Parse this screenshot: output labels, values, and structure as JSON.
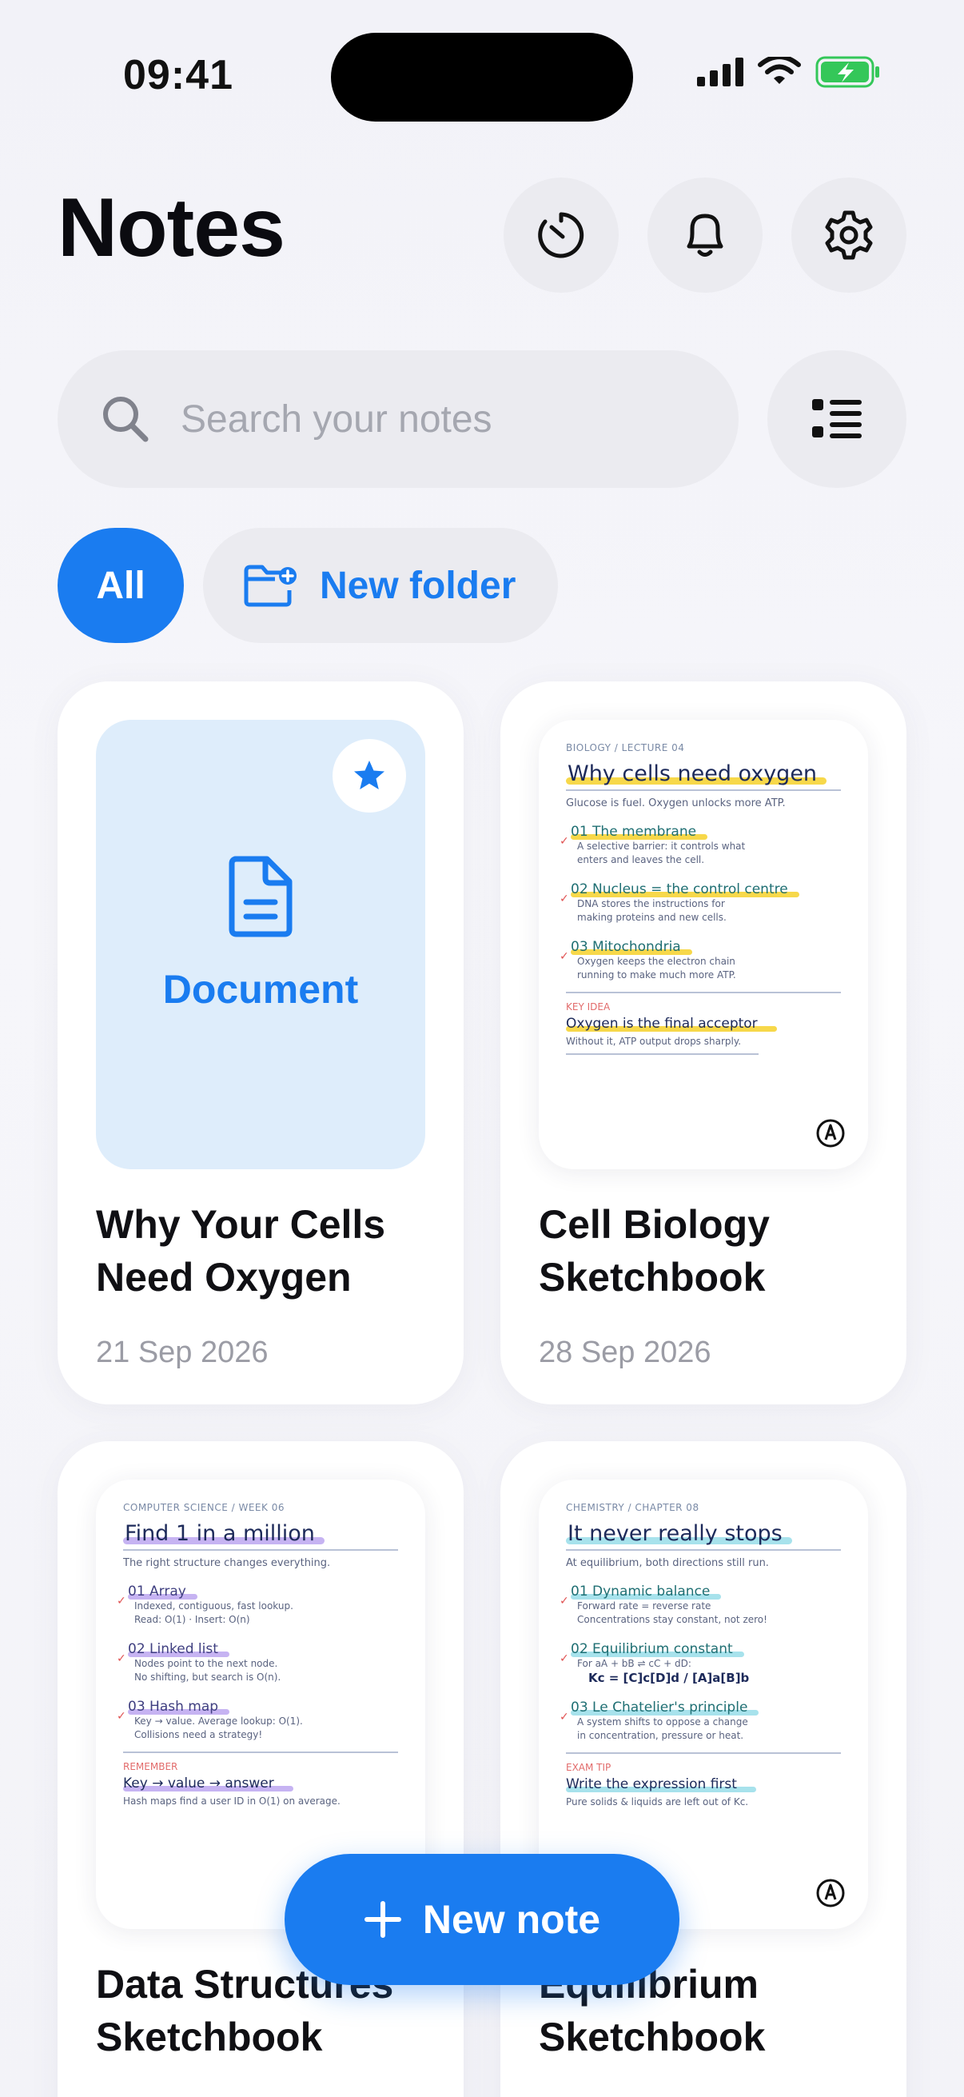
{
  "status": {
    "time": "09:41"
  },
  "header": {
    "title": "Notes"
  },
  "search": {
    "placeholder": "Search your notes",
    "value": ""
  },
  "filters": {
    "all_label": "All",
    "new_folder_label": "New folder"
  },
  "notes": [
    {
      "title": "Why Your Cells Need Oxygen",
      "date": "21 Sep 2026",
      "type_label": "Document",
      "starred": true
    },
    {
      "title": "Cell Biology Sketchbook",
      "date": "28 Sep 2026",
      "page": {
        "crumb": "BIOLOGY  /  LECTURE 04",
        "heading": "Why cells need oxygen",
        "sub": "Glucose is fuel. Oxygen unlocks more ATP.",
        "items": [
          {
            "h": "01  The membrane",
            "d1": "A selective barrier: it controls what",
            "d2": "enters and leaves the cell."
          },
          {
            "h": "02  Nucleus = the control centre",
            "d1": "DNA stores the instructions for",
            "d2": "making proteins and new cells."
          },
          {
            "h": "03  Mitochondria",
            "d1": "Oxygen keeps the electron chain",
            "d2": "running to make much more ATP."
          }
        ],
        "key_label": "KEY IDEA",
        "key_heading": "Oxygen is the final acceptor",
        "key_desc": "Without it, ATP output drops sharply."
      }
    },
    {
      "title": "Data Structures Sketchbook",
      "date": "",
      "page": {
        "crumb": "COMPUTER SCIENCE  /  WEEK 06",
        "heading": "Find 1 in a million",
        "sub": "The right structure changes everything.",
        "items": [
          {
            "h": "01  Array",
            "d1": "Indexed, contiguous, fast lookup.",
            "d2": "Read: O(1)  ·  Insert: O(n)"
          },
          {
            "h": "02  Linked list",
            "d1": "Nodes point to the next node.",
            "d2": "No shifting, but search is O(n)."
          },
          {
            "h": "03  Hash map",
            "d1": "Key → value. Average lookup: O(1).",
            "d2": "Collisions need a strategy!"
          }
        ],
        "key_label": "REMEMBER",
        "key_heading": "Key → value → answer",
        "key_desc": "Hash maps find a user ID in O(1) on average."
      }
    },
    {
      "title": "Equilibrium Sketchbook",
      "date": "",
      "page": {
        "crumb": "CHEMISTRY  /  CHAPTER 08",
        "heading": "It never really stops",
        "sub": "At equilibrium, both directions still run.",
        "items": [
          {
            "h": "01  Dynamic balance",
            "d1": "Forward rate = reverse rate",
            "d2": "Concentrations stay constant, not zero!"
          },
          {
            "h": "02  Equilibrium constant",
            "d1": "For aA + bB ⇌ cC + dD:",
            "d2": ""
          },
          {
            "h": "03  Le Chatelier's principle",
            "d1": "A system shifts to oppose a change",
            "d2": "in concentration, pressure or heat."
          }
        ],
        "formula": "Kc = [C]c[D]d / [A]a[B]b",
        "key_label": "EXAM TIP",
        "key_heading": "Write the expression first",
        "key_desc": "Pure solids & liquids are left out of Kc."
      }
    }
  ],
  "fab": {
    "label": "New note"
  },
  "colors": {
    "accent": "#1a7cf0",
    "yellow_highlight": "#f7d84a",
    "purple_highlight": "#c6b3f2",
    "cyan_highlight": "#a7e2ec",
    "battery": "#34c759"
  },
  "icons": [
    "timer-icon",
    "bell-icon",
    "gear-icon",
    "search-icon",
    "list-view-icon",
    "folder-plus-icon",
    "star-icon",
    "document-icon",
    "pen-icon",
    "plus-icon"
  ]
}
